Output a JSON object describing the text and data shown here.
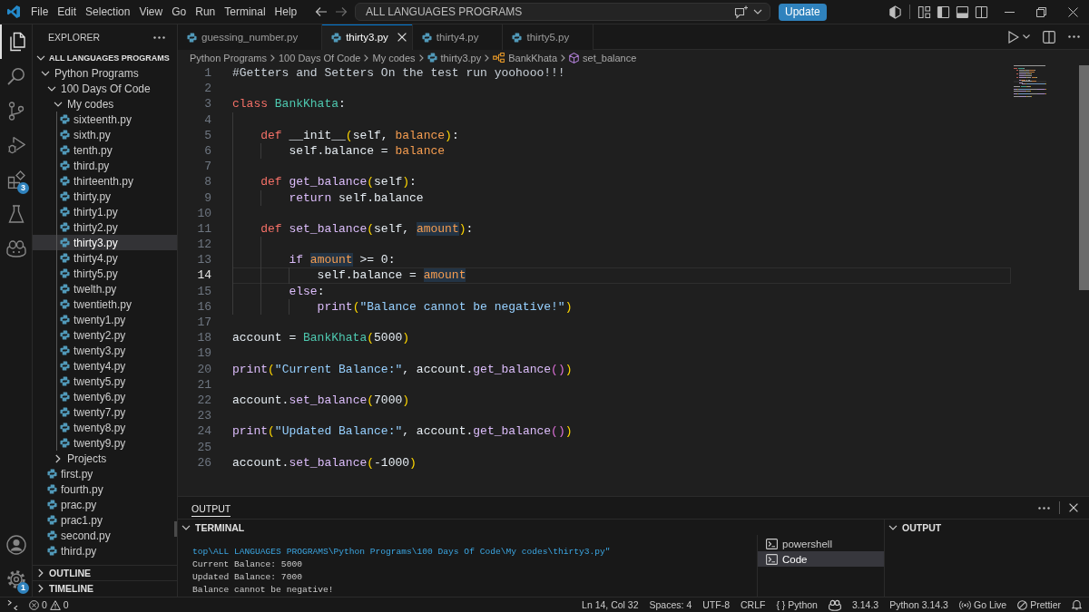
{
  "title_bar": {
    "menu": [
      "File",
      "Edit",
      "Selection",
      "View",
      "Go",
      "Run",
      "Terminal",
      "Help"
    ],
    "command_center": "ALL LANGUAGES PROGRAMS",
    "update_button": "Update"
  },
  "activity_bar": {
    "items": [
      {
        "kind": "explorer",
        "selected": true
      },
      {
        "kind": "search",
        "selected": false
      },
      {
        "kind": "source_control",
        "selected": false
      },
      {
        "kind": "run_debug",
        "selected": false
      },
      {
        "kind": "extensions",
        "selected": false,
        "badge": "3"
      },
      {
        "kind": "testing",
        "selected": false
      },
      {
        "kind": "copilot",
        "selected": false
      }
    ],
    "bottom_items": [
      {
        "kind": "account"
      },
      {
        "kind": "settings",
        "badge": "1"
      }
    ]
  },
  "sidebar": {
    "title": "EXPLORER",
    "workspace": {
      "label": "ALL LANGUAGES PROGRAMS",
      "expanded": true
    },
    "tree": [
      {
        "name": "Python Programs",
        "kind": "folder",
        "expanded": true,
        "selected": false,
        "children": [
          {
            "name": "100 Days Of Code",
            "kind": "folder",
            "expanded": true,
            "selected": false,
            "children": [
              {
                "name": "My codes",
                "kind": "folder",
                "expanded": true,
                "selected": false,
                "children": [
                  {
                    "name": "sixteenth.py",
                    "kind": "file",
                    "selected": false
                  },
                  {
                    "name": "sixth.py",
                    "kind": "file",
                    "selected": false
                  },
                  {
                    "name": "tenth.py",
                    "kind": "file",
                    "selected": false
                  },
                  {
                    "name": "third.py",
                    "kind": "file",
                    "selected": false
                  },
                  {
                    "name": "thirteenth.py",
                    "kind": "file",
                    "selected": false
                  },
                  {
                    "name": "thirty.py",
                    "kind": "file",
                    "selected": false
                  },
                  {
                    "name": "thirty1.py",
                    "kind": "file",
                    "selected": false
                  },
                  {
                    "name": "thirty2.py",
                    "kind": "file",
                    "selected": false
                  },
                  {
                    "name": "thirty3.py",
                    "kind": "file",
                    "selected": true
                  },
                  {
                    "name": "thirty4.py",
                    "kind": "file",
                    "selected": false
                  },
                  {
                    "name": "thirty5.py",
                    "kind": "file",
                    "selected": false
                  },
                  {
                    "name": "twelth.py",
                    "kind": "file",
                    "selected": false
                  },
                  {
                    "name": "twentieth.py",
                    "kind": "file",
                    "selected": false
                  },
                  {
                    "name": "twenty1.py",
                    "kind": "file",
                    "selected": false
                  },
                  {
                    "name": "twenty2.py",
                    "kind": "file",
                    "selected": false
                  },
                  {
                    "name": "twenty3.py",
                    "kind": "file",
                    "selected": false
                  },
                  {
                    "name": "twenty4.py",
                    "kind": "file",
                    "selected": false
                  },
                  {
                    "name": "twenty5.py",
                    "kind": "file",
                    "selected": false
                  },
                  {
                    "name": "twenty6.py",
                    "kind": "file",
                    "selected": false
                  },
                  {
                    "name": "twenty7.py",
                    "kind": "file",
                    "selected": false
                  },
                  {
                    "name": "twenty8.py",
                    "kind": "file",
                    "selected": false
                  },
                  {
                    "name": "twenty9.py",
                    "kind": "file",
                    "selected": false
                  }
                ]
              },
              {
                "name": "Projects",
                "kind": "folder",
                "expanded": false,
                "selected": false
              }
            ]
          },
          {
            "name": "first.py",
            "kind": "file",
            "selected": false
          },
          {
            "name": "fourth.py",
            "kind": "file",
            "selected": false
          },
          {
            "name": "prac.py",
            "kind": "file",
            "selected": false
          },
          {
            "name": "prac1.py",
            "kind": "file",
            "selected": false
          },
          {
            "name": "second.py",
            "kind": "file",
            "selected": false
          },
          {
            "name": "third.py",
            "kind": "file",
            "selected": false
          }
        ]
      }
    ],
    "sections": [
      {
        "label": "OUTLINE",
        "expanded": false
      },
      {
        "label": "TIMELINE",
        "expanded": false
      }
    ]
  },
  "tabs": [
    {
      "label": "guessing_number.py",
      "selected": false
    },
    {
      "label": "thirty3.py",
      "selected": true
    },
    {
      "label": "thirty4.py",
      "selected": false
    },
    {
      "label": "thirty5.py",
      "selected": false
    }
  ],
  "breadcrumb": [
    {
      "label": "Python Programs",
      "kind": "folder"
    },
    {
      "label": "100 Days Of Code",
      "kind": "folder"
    },
    {
      "label": "My codes",
      "kind": "folder"
    },
    {
      "label": "thirty3.py",
      "kind": "file"
    },
    {
      "label": "BankKhata",
      "kind": "class"
    },
    {
      "label": "set_balance",
      "kind": "method"
    }
  ],
  "editor": {
    "lines": [
      {
        "number": "1",
        "current": false,
        "tokens": [
          {
            "text": "#Getters and Setters On the test run yoohooo!!!",
            "kind": "comment"
          }
        ]
      },
      {
        "number": "2",
        "current": false
      },
      {
        "number": "3",
        "current": false,
        "tokens": [
          {
            "text": "class ",
            "kind": "keyword"
          },
          {
            "text": "BankKhata",
            "kind": "class"
          },
          {
            "text": ":",
            "kind": "text"
          }
        ]
      },
      {
        "number": "4",
        "current": false
      },
      {
        "number": "5",
        "current": false,
        "tokens": [
          {
            "text": "    def ",
            "kind": "keyword"
          },
          {
            "text": "__init__",
            "kind": "text"
          },
          {
            "text": "(",
            "kind": "bracket1"
          },
          {
            "text": "self, ",
            "kind": "text"
          },
          {
            "text": "balance",
            "kind": "param"
          },
          {
            "text": ")",
            "kind": "bracket1"
          },
          {
            "text": ":",
            "kind": "text"
          }
        ]
      },
      {
        "number": "6",
        "current": false,
        "tokens": [
          {
            "text": "        self.balance = ",
            "kind": "text"
          },
          {
            "text": "balance",
            "kind": "param"
          }
        ]
      },
      {
        "number": "7",
        "current": false
      },
      {
        "number": "8",
        "current": false,
        "tokens": [
          {
            "text": "    def ",
            "kind": "keyword"
          },
          {
            "text": "get_balance",
            "kind": "func"
          },
          {
            "text": "(",
            "kind": "bracket1"
          },
          {
            "text": "self",
            "kind": "text"
          },
          {
            "text": ")",
            "kind": "bracket1"
          },
          {
            "text": ":",
            "kind": "text"
          }
        ]
      },
      {
        "number": "9",
        "current": false,
        "tokens": [
          {
            "text": "        return ",
            "kind": "control"
          },
          {
            "text": "self.balance",
            "kind": "text"
          }
        ]
      },
      {
        "number": "10",
        "current": false
      },
      {
        "number": "11",
        "current": false,
        "tokens": [
          {
            "text": "    def ",
            "kind": "keyword"
          },
          {
            "text": "set_balance",
            "kind": "func"
          },
          {
            "text": "(",
            "kind": "bracket1"
          },
          {
            "text": "self, ",
            "kind": "text"
          },
          {
            "text": "amount",
            "kind": "param_match"
          },
          {
            "text": ")",
            "kind": "bracket1"
          },
          {
            "text": ":",
            "kind": "text"
          }
        ]
      },
      {
        "number": "12",
        "current": false
      },
      {
        "number": "13",
        "current": false,
        "tokens": [
          {
            "text": "        if ",
            "kind": "control"
          },
          {
            "text": "amount",
            "kind": "param_match"
          },
          {
            "text": " >= ",
            "kind": "text"
          },
          {
            "text": "0",
            "kind": "number"
          },
          {
            "text": ":",
            "kind": "text"
          }
        ]
      },
      {
        "number": "14",
        "current": true,
        "tokens": [
          {
            "text": "            self.balance = ",
            "kind": "text"
          },
          {
            "text": "amount",
            "kind": "param_match"
          }
        ]
      },
      {
        "number": "15",
        "current": false,
        "tokens": [
          {
            "text": "        else",
            "kind": "control"
          },
          {
            "text": ":",
            "kind": "text"
          }
        ]
      },
      {
        "number": "16",
        "current": false,
        "tokens": [
          {
            "text": "            print",
            "kind": "func"
          },
          {
            "text": "(",
            "kind": "bracket1"
          },
          {
            "text": "\"Balance cannot be negative!\"",
            "kind": "string"
          },
          {
            "text": ")",
            "kind": "bracket1"
          }
        ]
      },
      {
        "number": "17",
        "current": false
      },
      {
        "number": "18",
        "current": false,
        "tokens": [
          {
            "text": "account = ",
            "kind": "text"
          },
          {
            "text": "BankKhata",
            "kind": "class"
          },
          {
            "text": "(",
            "kind": "bracket1"
          },
          {
            "text": "5000",
            "kind": "number"
          },
          {
            "text": ")",
            "kind": "bracket1"
          }
        ]
      },
      {
        "number": "19",
        "current": false
      },
      {
        "number": "20",
        "current": false,
        "tokens": [
          {
            "text": "print",
            "kind": "func"
          },
          {
            "text": "(",
            "kind": "bracket1"
          },
          {
            "text": "\"Current Balance:\"",
            "kind": "string"
          },
          {
            "text": ", account.",
            "kind": "text"
          },
          {
            "text": "get_balance",
            "kind": "func"
          },
          {
            "text": "()",
            "kind": "bracket2"
          },
          {
            "text": ")",
            "kind": "bracket1"
          }
        ]
      },
      {
        "number": "21",
        "current": false
      },
      {
        "number": "22",
        "current": false,
        "tokens": [
          {
            "text": "account.",
            "kind": "text"
          },
          {
            "text": "set_balance",
            "kind": "func"
          },
          {
            "text": "(",
            "kind": "bracket1"
          },
          {
            "text": "7000",
            "kind": "number"
          },
          {
            "text": ")",
            "kind": "bracket1"
          }
        ]
      },
      {
        "number": "23",
        "current": false
      },
      {
        "number": "24",
        "current": false,
        "tokens": [
          {
            "text": "print",
            "kind": "func"
          },
          {
            "text": "(",
            "kind": "bracket1"
          },
          {
            "text": "\"Updated Balance:\"",
            "kind": "string"
          },
          {
            "text": ", account.",
            "kind": "text"
          },
          {
            "text": "get_balance",
            "kind": "func"
          },
          {
            "text": "()",
            "kind": "bracket2"
          },
          {
            "text": ")",
            "kind": "bracket1"
          }
        ]
      },
      {
        "number": "25",
        "current": false
      },
      {
        "number": "26",
        "current": false,
        "tokens": [
          {
            "text": "account.",
            "kind": "text"
          },
          {
            "text": "set_balance",
            "kind": "func"
          },
          {
            "text": "(",
            "kind": "bracket1"
          },
          {
            "text": "-1000",
            "kind": "number"
          },
          {
            "text": ")",
            "kind": "bracket1"
          }
        ]
      }
    ]
  },
  "panel": {
    "tabs": [
      {
        "label": "OUTPUT",
        "selected": true
      }
    ],
    "terminal": {
      "title": "TERMINAL",
      "expanded": true,
      "lines": [
        {
          "text": "top\\ALL LANGUAGES PROGRAMS\\Python Programs\\100 Days Of Code\\My codes\\thirty3.py\"",
          "kind": "command"
        },
        {
          "text": "Current Balance: 5000",
          "kind": "output"
        },
        {
          "text": "Updated Balance: 7000",
          "kind": "output"
        },
        {
          "text": "Balance cannot be negative!",
          "kind": "output"
        }
      ],
      "sessions": [
        {
          "label": "powershell",
          "selected": false
        },
        {
          "label": "Code",
          "selected": true
        }
      ]
    },
    "output": {
      "title": "OUTPUT",
      "expanded": true
    }
  },
  "status_bar": {
    "errors": "0",
    "warnings": "0",
    "items": [
      {
        "kind": "text",
        "label": "Ln 14, Col 32"
      },
      {
        "kind": "text",
        "label": "Spaces: 4"
      },
      {
        "kind": "text",
        "label": "UTF-8"
      },
      {
        "kind": "text",
        "label": "CRLF"
      },
      {
        "kind": "language",
        "icon": "{ }",
        "label": "Python"
      },
      {
        "kind": "copilot"
      },
      {
        "kind": "text",
        "label": "3.14.3"
      },
      {
        "kind": "text",
        "label": "Python 3.14.3"
      },
      {
        "kind": "live",
        "label": "Go Live"
      },
      {
        "kind": "prettier",
        "label": "Prettier"
      },
      {
        "kind": "bell"
      }
    ]
  }
}
